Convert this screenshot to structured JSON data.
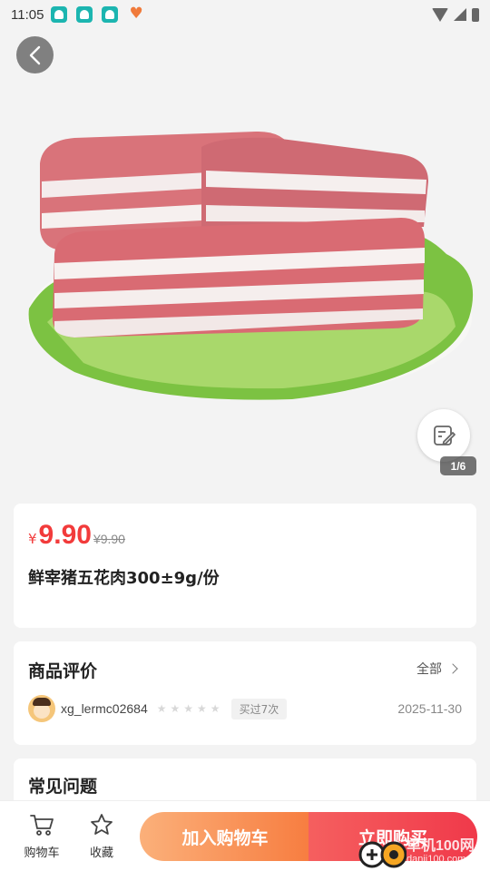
{
  "status_bar": {
    "time": "11:05"
  },
  "gallery": {
    "page_indicator": "1/6"
  },
  "price": {
    "currency": "¥",
    "current": "9.90",
    "original": "¥9.90"
  },
  "product": {
    "title": "鲜宰猪五花肉300±9g/份"
  },
  "reviews": {
    "title": "商品评价",
    "see_all": "全部",
    "items": [
      {
        "username": "xg_lermc02684",
        "rating": 0,
        "badge": "买过7次",
        "date": "2025-11-30"
      }
    ]
  },
  "faq": {
    "title": "常见问题"
  },
  "bottom_bar": {
    "cart_label": "购物车",
    "favorite_label": "收藏",
    "add_to_cart": "加入购物车",
    "buy_now": "立即购买"
  },
  "watermark": {
    "line1": "单机100网",
    "line2": "danji100.com"
  },
  "colors": {
    "price_red": "#f23b3b",
    "cart_orange": "#f77d40",
    "buy_red": "#f0394a"
  },
  "icons": [
    "back-arrow-icon",
    "edit-icon",
    "cart-icon",
    "star-icon"
  ]
}
